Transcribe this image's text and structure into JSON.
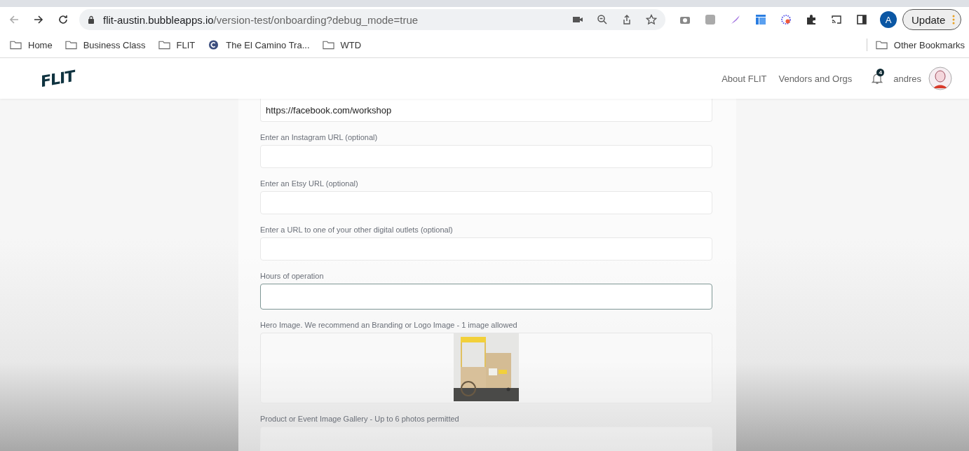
{
  "browser": {
    "url_host": "flit-austin.bubbleapps.io",
    "url_path": "/version-test/onboarding?debug_mode=true",
    "profile_initial": "A",
    "update_button": "Update",
    "bookmarks": [
      {
        "kind": "folder",
        "label": "Home"
      },
      {
        "kind": "folder",
        "label": "Business Class"
      },
      {
        "kind": "folder",
        "label": "FLIT"
      },
      {
        "kind": "site",
        "label": "The El Camino Tra..."
      },
      {
        "kind": "folder",
        "label": "WTD"
      }
    ],
    "other_bookmarks": "Other Bookmarks"
  },
  "header": {
    "logo": "FLIT",
    "nav": [
      "About FLIT",
      "Vendors and Orgs"
    ],
    "notification_count": "4",
    "username": "andres"
  },
  "form": {
    "fields": [
      {
        "kind": "text",
        "value": "https://facebook.com/workshop",
        "focused": false
      },
      {
        "kind": "text",
        "label": "Enter an Instagram URL (optional)",
        "focused": false
      },
      {
        "kind": "text",
        "label": "Enter an Etsy URL (optional)",
        "focused": false
      },
      {
        "kind": "text",
        "label": "Enter a URL to one of your other digital outlets (optional)",
        "focused": false
      },
      {
        "kind": "text",
        "label": "Hours of operation",
        "focused": true
      },
      {
        "kind": "upload",
        "label": "Hero Image. We recommend an Branding or Logo Image - 1 image allowed",
        "filled": true
      },
      {
        "kind": "upload",
        "label": "Product or Event Image Gallery - Up to 6 photos permitted",
        "filled": false
      }
    ]
  }
}
